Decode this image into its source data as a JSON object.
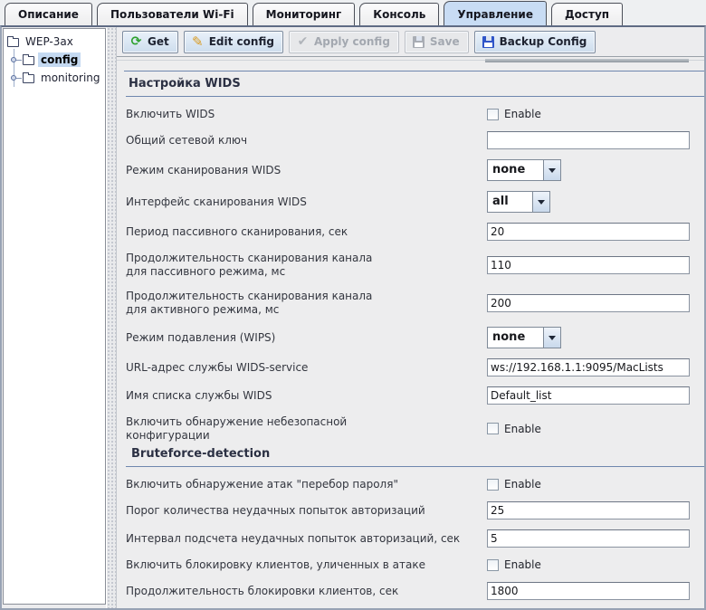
{
  "colors": {
    "selected_tab_bg": "#c8dcf4",
    "tree_selection_bg": "#c4d9f1",
    "section_underline": "#6f87ae",
    "button_border": "#7d8ca0",
    "refresh_icon_green": "#2ea12e",
    "pencil_icon_orange": "#d99a1f",
    "floppy_icon_blue": "#2f55c8",
    "disabled_text": "#a3a8b0"
  },
  "tabs": [
    {
      "label": "Описание",
      "selected": false
    },
    {
      "label": "Пользователи Wi-Fi",
      "selected": false
    },
    {
      "label": "Мониторинг",
      "selected": false
    },
    {
      "label": "Консоль",
      "selected": false
    },
    {
      "label": "Управление",
      "selected": true
    },
    {
      "label": "Доступ",
      "selected": false
    }
  ],
  "tree": {
    "root": "WEP-3ax",
    "children": [
      {
        "label": "config",
        "selected": true
      },
      {
        "label": "monitoring",
        "selected": false
      }
    ]
  },
  "toolbar": {
    "buttons": [
      {
        "label": "Get",
        "icon": "refresh-icon",
        "enabled": true
      },
      {
        "label": "Edit config",
        "icon": "pencil-icon",
        "enabled": true
      },
      {
        "label": "Apply config",
        "icon": "check-icon",
        "enabled": false
      },
      {
        "label": "Save",
        "icon": "save-floppy-icon",
        "enabled": false
      },
      {
        "label": "Backup Config",
        "icon": "backup-floppy-icon",
        "enabled": true
      }
    ]
  },
  "sections": [
    {
      "title": "Настройка WIDS",
      "rows": [
        {
          "type": "checkbox",
          "label": "Включить WIDS",
          "control_label": "Enable",
          "checked": false
        },
        {
          "type": "text",
          "label": "Общий сетевой ключ",
          "value": ""
        },
        {
          "type": "select",
          "label": "Режим сканирования WIDS",
          "value": "none",
          "width": 62
        },
        {
          "type": "select",
          "label": "Интерфейс сканирования WIDS",
          "value": "all",
          "width": 50
        },
        {
          "type": "text",
          "label": "Период пассивного сканирования, сек",
          "value": "20"
        },
        {
          "type": "text",
          "label": "Продолжительность сканирования канала",
          "label2": "для пассивного режима, мс",
          "value": "110"
        },
        {
          "type": "text",
          "label": "Продолжительность сканирования канала",
          "label2": "для активного режима, мс",
          "value": "200"
        },
        {
          "type": "select",
          "label": "Режим подавления (WIPS)",
          "value": "none",
          "width": 62
        },
        {
          "type": "text",
          "label": "URL-адрес службы WIDS-service",
          "value": "ws://192.168.1.1:9095/MacLists"
        },
        {
          "type": "text",
          "label": "Имя списка службы WIDS",
          "value": "Default_list"
        },
        {
          "type": "checkbox",
          "label": "Включить обнаружение небезопасной",
          "label2": "конфигурации",
          "control_label": "Enable",
          "checked": false
        }
      ]
    },
    {
      "title": "Bruteforce-detection",
      "rows": [
        {
          "type": "checkbox",
          "label": "Включить обнаружение атак \"перебор пароля\"",
          "control_label": "Enable",
          "checked": false
        },
        {
          "type": "text",
          "label": "Порог количества неудачных попыток авторизаций",
          "value": "25"
        },
        {
          "type": "text",
          "label": "Интервал подсчета неудачных попыток авторизаций, сек",
          "value": "5"
        },
        {
          "type": "checkbox",
          "label": "Включить блокировку клиентов, уличенных в атаке",
          "control_label": "Enable",
          "checked": false
        },
        {
          "type": "text",
          "label": "Продолжительность блокировки клиентов, сек",
          "value": "1800"
        }
      ]
    }
  ]
}
